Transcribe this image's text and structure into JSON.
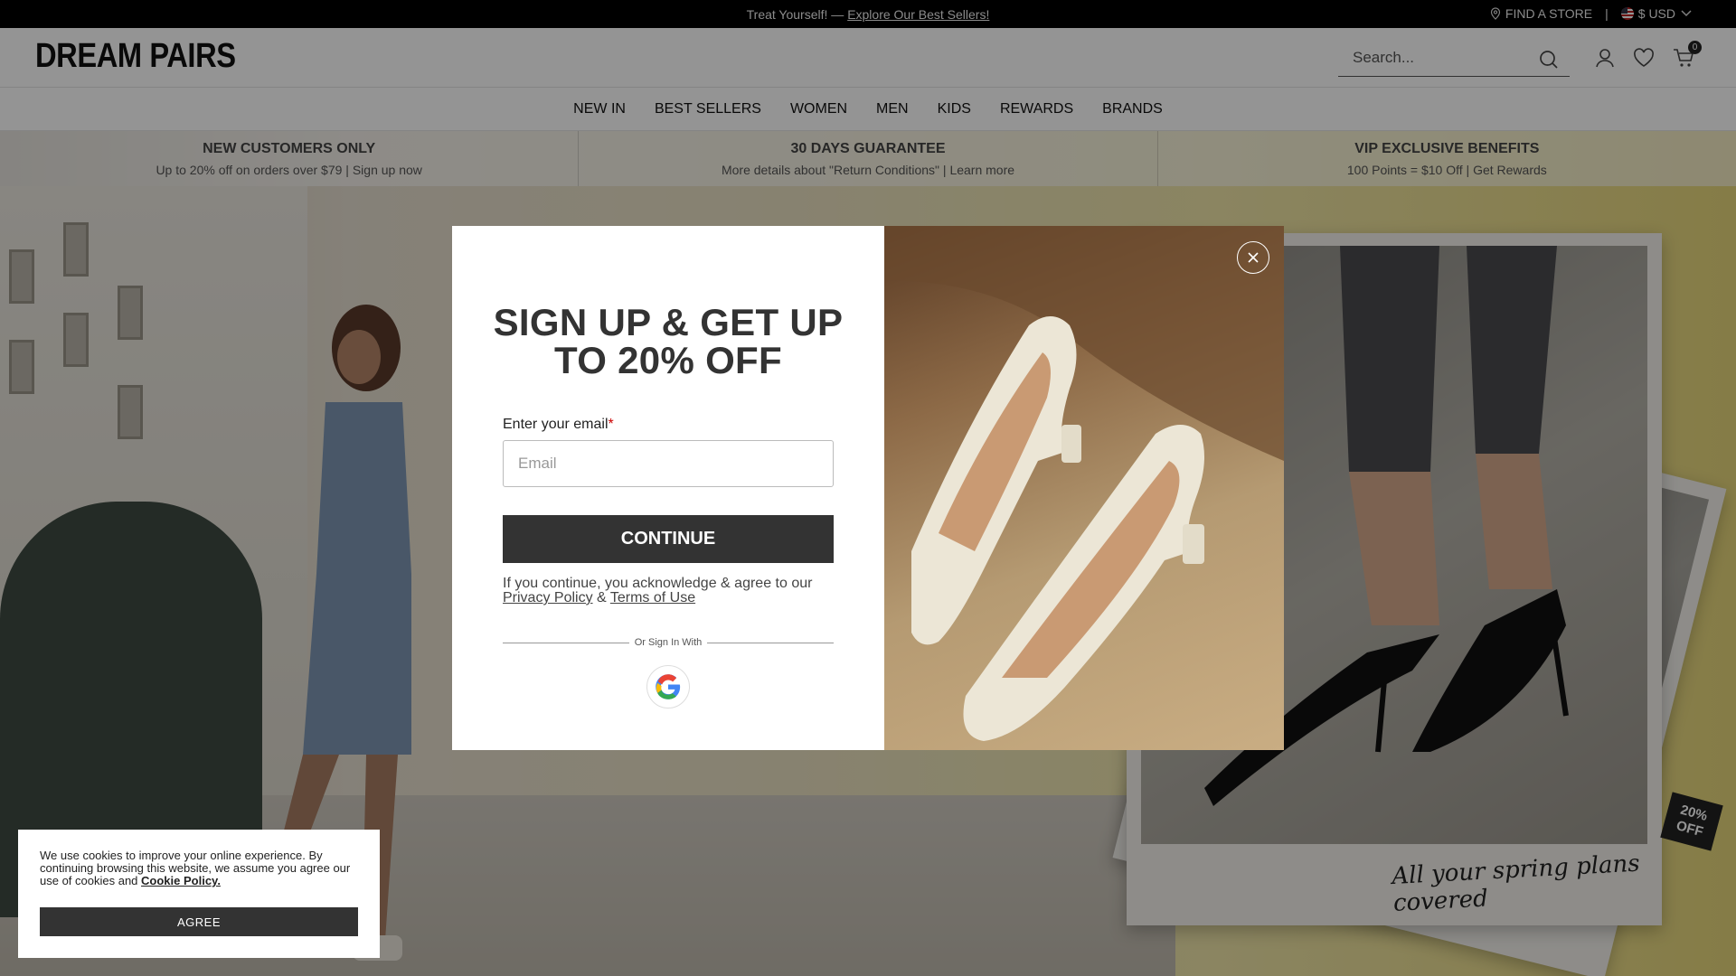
{
  "topbar": {
    "promo_text": "Treat Yourself! — ",
    "promo_link": "Explore Our Best Sellers!",
    "find_store": "FIND A STORE",
    "separator": "|",
    "currency": "$ USD"
  },
  "header": {
    "logo": "DREAM PAIRS",
    "search_placeholder": "Search...",
    "cart_count": "0"
  },
  "nav": {
    "items": [
      "NEW IN",
      "BEST SELLERS",
      "WOMEN",
      "MEN",
      "KIDS",
      "REWARDS",
      "BRANDS"
    ]
  },
  "benefits": [
    {
      "title": "NEW CUSTOMERS ONLY",
      "subtitle": "Up to 20% off on orders over $79 | Sign up now"
    },
    {
      "title": "30 DAYS GUARANTEE",
      "subtitle": "More details about \"Return Conditions\" | Learn more"
    },
    {
      "title": "VIP EXCLUSIVE BENEFITS",
      "subtitle": "100 Points = $10 Off | Get Rewards"
    }
  ],
  "hero": {
    "caption": "All your spring plans covered",
    "tag": "20% OFF"
  },
  "modal": {
    "heading": "SIGN UP & GET UP TO 20% OFF",
    "email_label": "Enter your email",
    "required_mark": "*",
    "email_placeholder": "Email",
    "continue_label": "CONTINUE",
    "legal_text": "If you continue, you acknowledge & agree to our",
    "privacy_link": "Privacy Policy",
    "amp": " & ",
    "terms_link": "Terms of Use",
    "divider_text": "Or Sign In With"
  },
  "cookie": {
    "text": "We use cookies to improve your online experience. By continuing browsing this website, we assume you agree our use of cookies and ",
    "link": "Cookie Policy.",
    "agree_label": "AGREE"
  },
  "colors": {
    "dark_button": "#333333",
    "overlay": "rgba(0,0,0,0.42)",
    "required": "#cc0000"
  }
}
